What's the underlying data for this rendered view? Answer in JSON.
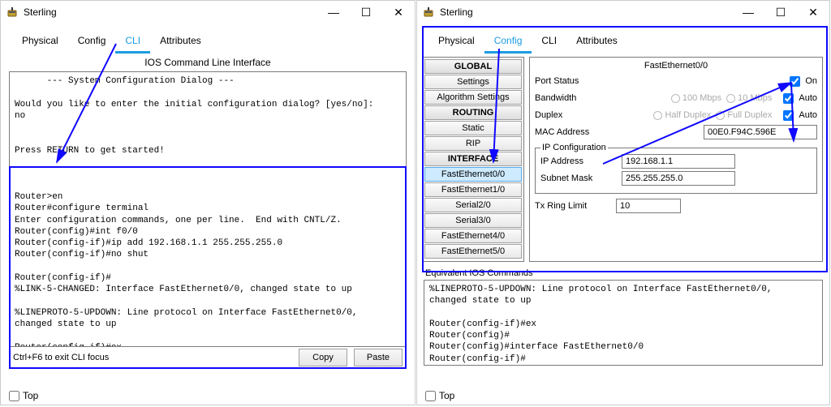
{
  "windowTitle": "Sterling",
  "tabs": {
    "physical": "Physical",
    "config": "Config",
    "cli": "CLI",
    "attributes": "Attributes"
  },
  "leftWindow": {
    "sectionTitle": "IOS Command Line Interface",
    "terminal": "      --- System Configuration Dialog ---\n\nWould you like to enter the initial configuration dialog? [yes/no]:\nno\n\n\nPress RETURN to get started!\n\n\n\nRouter>en\nRouter#configure terminal\nEnter configuration commands, one per line.  End with CNTL/Z.\nRouter(config)#int f0/0\nRouter(config-if)#ip add 192.168.1.1 255.255.255.0\nRouter(config-if)#no shut\n\nRouter(config-if)#\n%LINK-5-CHANGED: Interface FastEthernet0/0, changed state to up\n\n%LINEPROTO-5-UPDOWN: Line protocol on Interface FastEthernet0/0,\nchanged state to up\n\nRouter(config-if)#ex\nRouter(config)#",
    "hint": "Ctrl+F6 to exit CLI focus",
    "copy": "Copy",
    "paste": "Paste"
  },
  "rightWindow": {
    "side": {
      "global": "GLOBAL",
      "settings": "Settings",
      "algo": "Algorithm Settings",
      "routing": "ROUTING",
      "static": "Static",
      "rip": "RIP",
      "interface": "INTERFACE",
      "fe00": "FastEthernet0/0",
      "fe10": "FastEthernet1/0",
      "s20": "Serial2/0",
      "s30": "Serial3/0",
      "fe40": "FastEthernet4/0",
      "fe50": "FastEthernet5/0"
    },
    "detail": {
      "title": "FastEthernet0/0",
      "portStatus": "Port Status",
      "on": "On",
      "bandwidth": "Bandwidth",
      "bw100": "100 Mbps",
      "bw10": "10 Mbps",
      "auto": "Auto",
      "duplex": "Duplex",
      "half": "Half Duplex",
      "full": "Full Duplex",
      "mac": "MAC Address",
      "macVal": "00E0.F94C.596E",
      "ipconf": "IP Configuration",
      "ipaddr": "IP Address",
      "ipVal": "192.168.1.1",
      "subnet": "Subnet Mask",
      "subnetVal": "255.255.255.0",
      "txring": "Tx Ring Limit",
      "txringVal": "10"
    },
    "eqLabel": "Equivalent IOS Commands",
    "terminal": "%LINEPROTO-5-UPDOWN: Line protocol on Interface FastEthernet0/0,\nchanged state to up\n\nRouter(config-if)#ex\nRouter(config)#\nRouter(config)#interface FastEthernet0/0\nRouter(config-if)#"
  },
  "topLabel": "Top"
}
